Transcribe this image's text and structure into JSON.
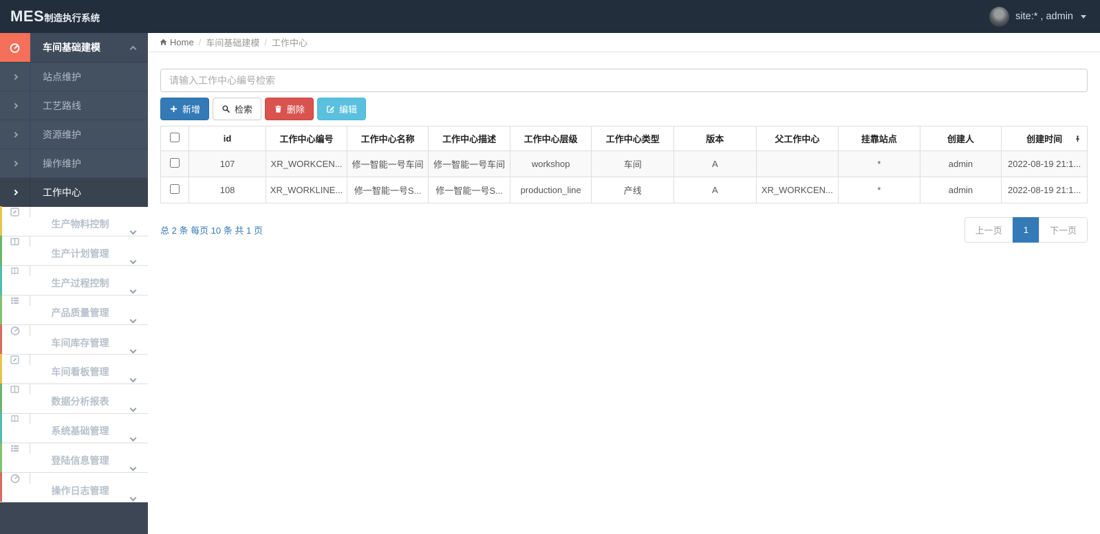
{
  "colors": {
    "navbar_bg": "#222e3c",
    "sidebar_item_bg": "#445161",
    "active_menu_icon_bg": "#f4705a",
    "primary": "#337ab7",
    "danger": "#d9534f",
    "info": "#5bc0de"
  },
  "navbar": {
    "logo_primary": "MES",
    "logo_secondary": "制造执行系统",
    "user_label": "site:* , admin"
  },
  "breadcrumb": {
    "home": "Home",
    "crumbs": [
      "车间基础建模",
      "工作中心"
    ]
  },
  "sidebar": {
    "parent": {
      "label": "车间基础建模",
      "icon": "gauge-icon"
    },
    "sub_items": [
      {
        "label": "站点维护"
      },
      {
        "label": "工艺路线"
      },
      {
        "label": "资源维护"
      },
      {
        "label": "操作维护"
      },
      {
        "label": "工作中心",
        "active": true
      }
    ],
    "main_items": [
      {
        "label": "生产物料控制",
        "icon": "pencil-square-icon",
        "stripe": "#e9c348"
      },
      {
        "label": "生产计划管理",
        "icon": "columns-icon",
        "stripe": "#6db26d"
      },
      {
        "label": "生产过程控制",
        "icon": "book-icon",
        "stripe": "#4fbcad"
      },
      {
        "label": "产品质量管理",
        "icon": "list-icon",
        "stripe": "#7fbf6e"
      },
      {
        "label": "车间库存管理",
        "icon": "gauge-icon",
        "stripe": "#d96a62"
      },
      {
        "label": "车间看板管理",
        "icon": "pencil-square-icon",
        "stripe": "#e9c348"
      },
      {
        "label": "数据分析报表",
        "icon": "columns-icon",
        "stripe": "#6db26d"
      },
      {
        "label": "系统基础管理",
        "icon": "book-icon",
        "stripe": "#4fbcad"
      },
      {
        "label": "登陆信息管理",
        "icon": "list-icon",
        "stripe": "#7fbf6e"
      },
      {
        "label": "操作日志管理",
        "icon": "gauge-icon",
        "stripe": "#d96a62"
      }
    ]
  },
  "toolbar": {
    "search_placeholder": "请输入工作中心编号检索",
    "add_label": "新增",
    "search_label": "检索",
    "delete_label": "删除",
    "edit_label": "编辑"
  },
  "table": {
    "headers": [
      "id",
      "工作中心编号",
      "工作中心名称",
      "工作中心描述",
      "工作中心层级",
      "工作中心类型",
      "版本",
      "父工作中心",
      "挂靠站点",
      "创建人",
      "创建时间"
    ],
    "rows": [
      {
        "id": "107",
        "code": "XR_WORKCEN...",
        "name": "修一智能一号车间",
        "desc": "修一智能一号车间",
        "level": "workshop",
        "type": "车间",
        "version": "A",
        "parent": "",
        "station": "*",
        "creator": "admin",
        "created": "2022-08-19 21:1..."
      },
      {
        "id": "108",
        "code": "XR_WORKLINE...",
        "name": "修一智能一号S...",
        "desc": "修一智能一号S...",
        "level": "production_line",
        "type": "产线",
        "version": "A",
        "parent": "XR_WORKCEN...",
        "station": "*",
        "creator": "admin",
        "created": "2022-08-19 21:1..."
      }
    ]
  },
  "pagination": {
    "summary": "总 2 条 每页 10 条 共 1 页",
    "prev_label": "上一页",
    "page": "1",
    "next_label": "下一页"
  }
}
